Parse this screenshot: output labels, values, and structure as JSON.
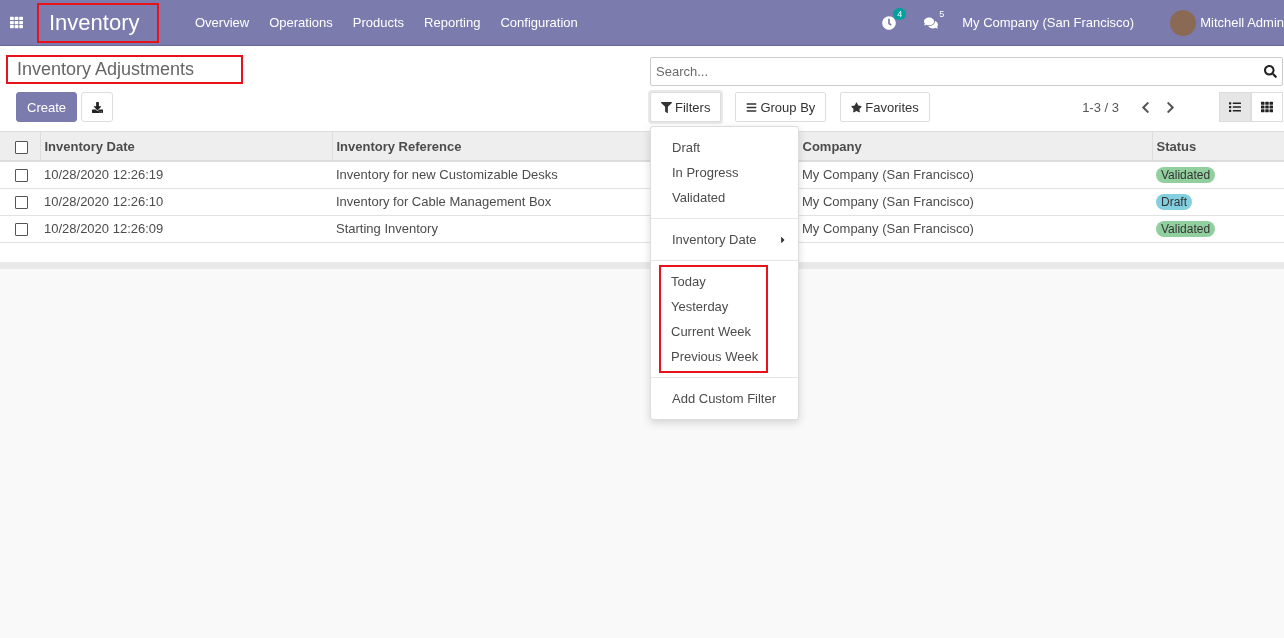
{
  "navbar": {
    "app_title": {
      "text": "Inventory",
      "highlighted": true
    },
    "menu": [
      "Overview",
      "Operations",
      "Products",
      "Reporting",
      "Configuration"
    ],
    "activity_count": "4",
    "message_count": "5",
    "company": "My Company (San Francisco)",
    "user": "Mitchell Admin"
  },
  "page_title": {
    "text": "Inventory Adjustments",
    "highlighted": true
  },
  "create_button": "Create",
  "search": {
    "placeholder": "Search..."
  },
  "filter_buttons": [
    {
      "label": "Filters",
      "selected": true
    },
    {
      "label": "Group By",
      "selected": false
    },
    {
      "label": "Favorites",
      "selected": false
    }
  ],
  "pager": "1-3 / 3",
  "views": [
    {
      "selected": true
    },
    {
      "selected": false
    }
  ],
  "table": {
    "select_all_checked": false,
    "columns": [
      "Inventory Date",
      "Inventory Reference",
      "Company",
      "Status"
    ],
    "rows": [
      {
        "checked": false,
        "cells": [
          "10/28/2020 12:26:19",
          "Inventory for new Customizable Desks",
          "My Company (San Francisco)"
        ],
        "status": {
          "label": "Validated",
          "color": "#92cf9e"
        }
      },
      {
        "checked": false,
        "cells": [
          "10/28/2020 12:26:10",
          "Inventory for Cable Management Box",
          "My Company (San Francisco)"
        ],
        "status": {
          "label": "Draft",
          "color": "#82cfdf"
        }
      },
      {
        "checked": false,
        "cells": [
          "10/28/2020 12:26:09",
          "Starting Inventory",
          "My Company (San Francisco)"
        ],
        "status": {
          "label": "Validated",
          "color": "#92cf9e"
        }
      }
    ]
  },
  "filters_menu": {
    "groups": [
      {
        "highlighted": false,
        "items": [
          {
            "label": "Draft",
            "kind": "option"
          },
          {
            "label": "In Progress",
            "kind": "option"
          },
          {
            "label": "Validated",
            "kind": "option"
          }
        ]
      },
      {
        "highlighted": false,
        "items": [
          {
            "label": "Inventory Date",
            "kind": "submenu"
          }
        ]
      },
      {
        "highlighted": true,
        "items": [
          {
            "label": "Today",
            "kind": "option"
          },
          {
            "label": "Yesterday",
            "kind": "option"
          },
          {
            "label": "Current Week",
            "kind": "option"
          },
          {
            "label": "Previous Week",
            "kind": "option"
          }
        ]
      },
      {
        "highlighted": false,
        "items": [
          {
            "label": "Add Custom Filter",
            "kind": "option"
          }
        ]
      }
    ]
  }
}
